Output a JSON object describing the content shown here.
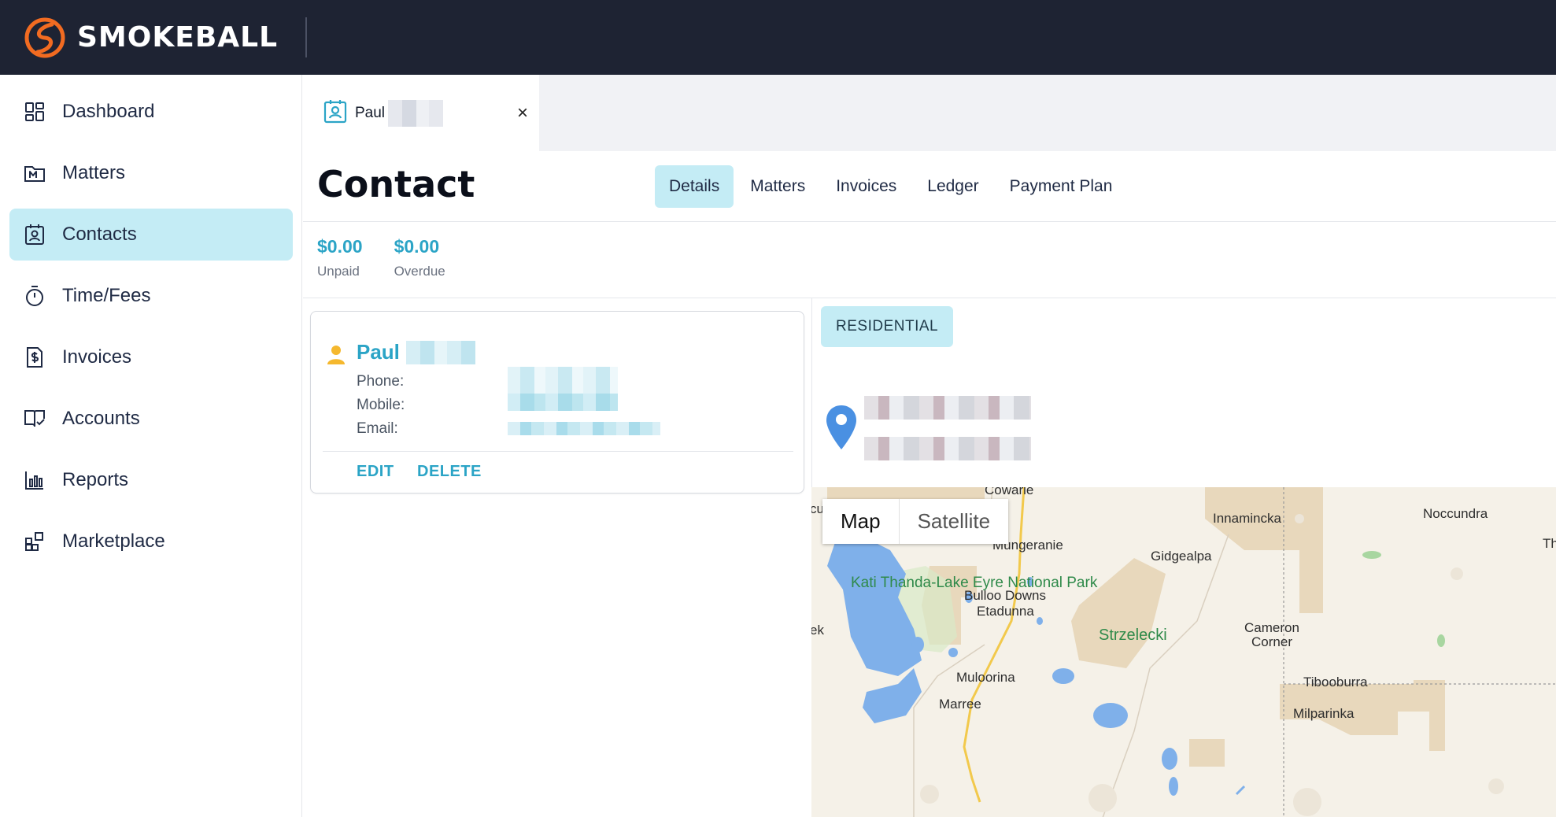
{
  "brand": {
    "name": "SMOKEBALL",
    "accent": "#f26b21"
  },
  "sidebar": {
    "items": [
      {
        "label": "Dashboard",
        "icon": "dashboard-icon"
      },
      {
        "label": "Matters",
        "icon": "matters-icon"
      },
      {
        "label": "Contacts",
        "icon": "contacts-icon",
        "active": true
      },
      {
        "label": "Time/Fees",
        "icon": "stopwatch-icon"
      },
      {
        "label": "Invoices",
        "icon": "invoice-icon"
      },
      {
        "label": "Accounts",
        "icon": "accounts-icon"
      },
      {
        "label": "Reports",
        "icon": "reports-icon"
      },
      {
        "label": "Marketplace",
        "icon": "marketplace-icon"
      }
    ]
  },
  "doc_tab": {
    "name": "Paul",
    "close": "×"
  },
  "page": {
    "title": "Contact",
    "tabs": [
      {
        "label": "Details",
        "active": true
      },
      {
        "label": "Matters"
      },
      {
        "label": "Invoices"
      },
      {
        "label": "Ledger"
      },
      {
        "label": "Payment Plan"
      }
    ]
  },
  "stats": {
    "unpaid_value": "$0.00",
    "unpaid_label": "Unpaid",
    "overdue_value": "$0.00",
    "overdue_label": "Overdue"
  },
  "contact_card": {
    "name": "Paul",
    "phone_label": "Phone:",
    "mobile_label": "Mobile:",
    "email_label": "Email:",
    "edit_label": "EDIT",
    "delete_label": "DELETE"
  },
  "address": {
    "type_label": "RESIDENTIAL"
  },
  "map": {
    "toggle_map": "Map",
    "toggle_satellite": "Satellite",
    "labels": {
      "cowarie": "Cowarie",
      "innamincka": "Innamincka",
      "noccundra": "Noccundra",
      "tha": "Tha",
      "mungeranie": "Mungeranie",
      "gidgealpa": "Gidgealpa",
      "park": "Kati Thanda-Lake Eyre National Park",
      "bulloo_downs": "Bulloo Downs",
      "etadunna": "Etadunna",
      "cameron_corner": "Cameron Corner",
      "strzelecki": "Strzelecki",
      "ek": "ek",
      "mulooorina": "Muloorina",
      "tibooburra": "Tibooburra",
      "marree": "Marree",
      "milparinka": "Milparinka",
      "cu": "cu"
    }
  }
}
